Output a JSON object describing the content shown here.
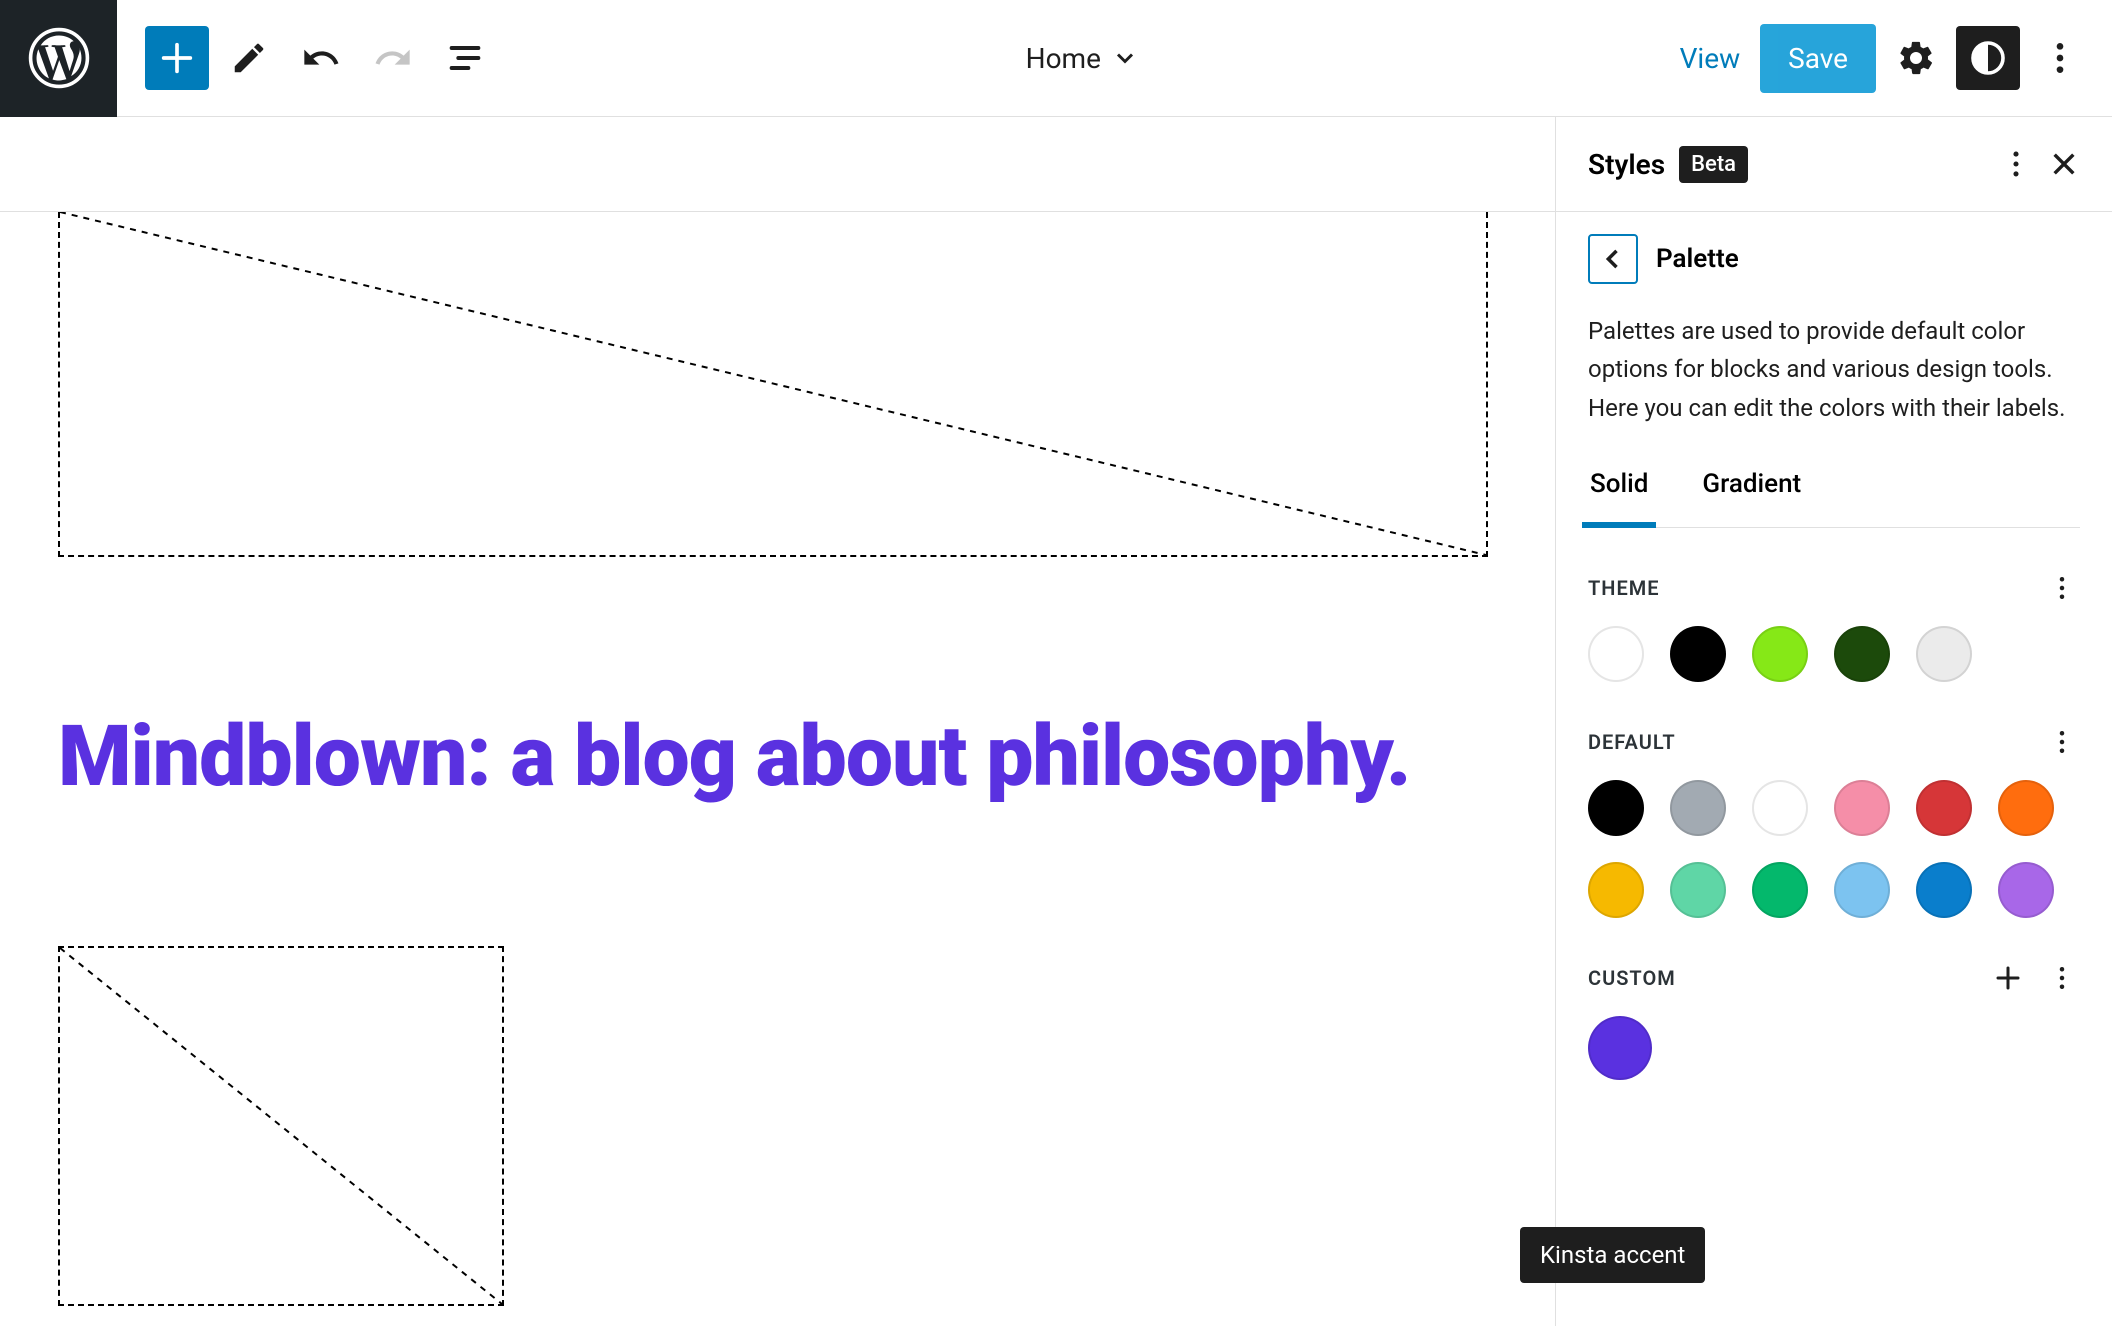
{
  "toolbar": {
    "template_label": "Home",
    "view": "View",
    "save": "Save"
  },
  "sidebar": {
    "title": "Styles",
    "badge": "Beta",
    "palette_title": "Palette",
    "palette_desc": "Palettes are used to provide default color options for blocks and various design tools. Here you can edit the colors with their labels.",
    "tabs": {
      "solid": "Solid",
      "gradient": "Gradient"
    },
    "sections": {
      "theme": {
        "label": "THEME",
        "colors": [
          "#ffffff",
          "#000000",
          "#86e817",
          "#1c4a0b",
          "#ebebeb"
        ]
      },
      "default": {
        "label": "DEFAULT",
        "colors": [
          "#000000",
          "#a2aab2",
          "#ffffff",
          "#f58ea8",
          "#d63638",
          "#ff6d0e",
          "#f6b900",
          "#5fd6a6",
          "#04b86c",
          "#7cc3f0",
          "#0a7ecc",
          "#a867e8"
        ]
      },
      "custom": {
        "label": "CUSTOM",
        "colors": [
          "#5a31e0"
        ]
      }
    }
  },
  "canvas": {
    "heading": "Mindblown: a blog about philosophy."
  },
  "tooltip": "Kinsta accent"
}
